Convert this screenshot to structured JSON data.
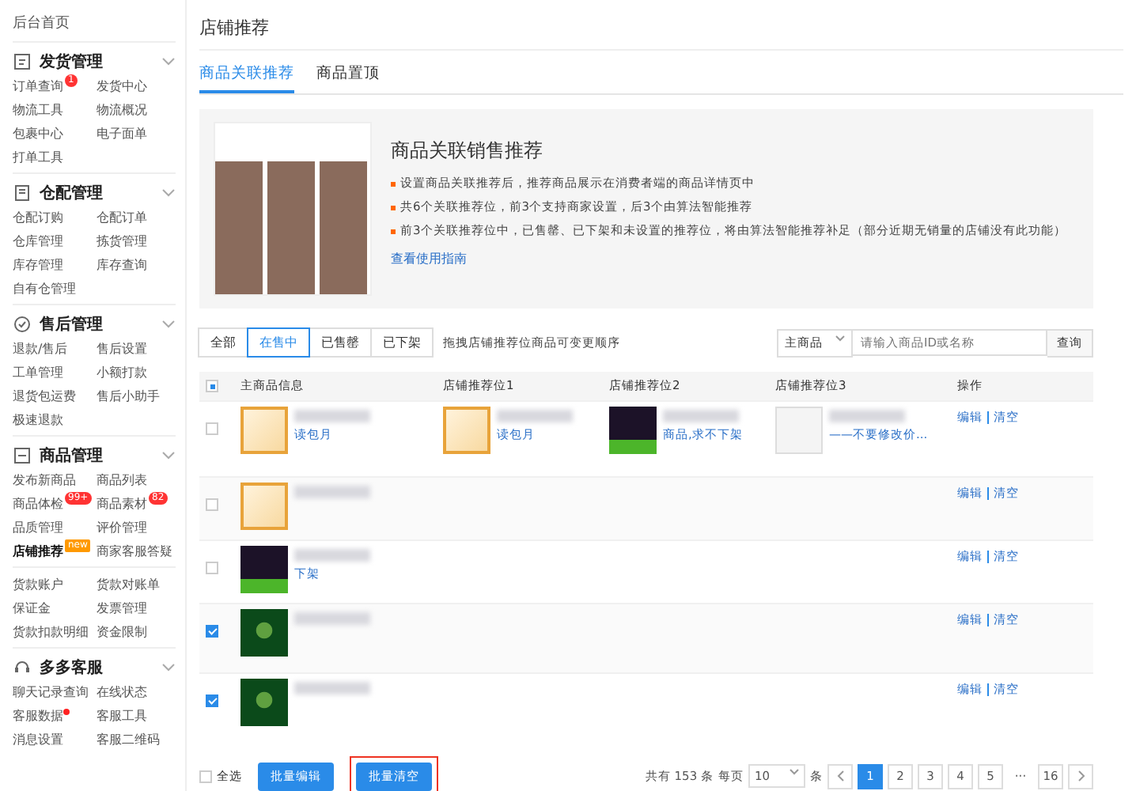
{
  "sidebar": {
    "home": "后台首页",
    "sections": [
      {
        "kind": "shipping",
        "title": "发货管理",
        "expanded": true,
        "items": [
          {
            "label": "订单查询",
            "badge": "1",
            "selected": false
          },
          {
            "label": "发货中心",
            "selected": false
          },
          {
            "label": "物流工具",
            "selected": false
          },
          {
            "label": "物流概况",
            "selected": false
          },
          {
            "label": "包裹中心",
            "selected": false
          },
          {
            "label": "电子面单",
            "selected": false
          },
          {
            "label": "打单工具",
            "selected": false
          }
        ]
      },
      {
        "kind": "warehouse",
        "title": "仓配管理",
        "expanded": true,
        "items": [
          {
            "label": "仓配订购",
            "selected": false
          },
          {
            "label": "仓配订单",
            "selected": false
          },
          {
            "label": "仓库管理",
            "selected": false
          },
          {
            "label": "拣货管理",
            "selected": false
          },
          {
            "label": "库存管理",
            "selected": false
          },
          {
            "label": "库存查询",
            "selected": false
          },
          {
            "label": "自有仓管理",
            "selected": false
          }
        ]
      },
      {
        "kind": "aftersale",
        "title": "售后管理",
        "expanded": true,
        "items": [
          {
            "label": "退款/售后",
            "selected": false
          },
          {
            "label": "售后设置",
            "selected": false
          },
          {
            "label": "工单管理",
            "selected": false
          },
          {
            "label": "小额打款",
            "selected": false
          },
          {
            "label": "退货包运费",
            "selected": false
          },
          {
            "label": "售后小助手",
            "selected": false
          },
          {
            "label": "极速退款",
            "selected": false
          }
        ]
      },
      {
        "kind": "goods",
        "title": "商品管理",
        "expanded": true,
        "items": [
          {
            "label": "发布新商品",
            "selected": false
          },
          {
            "label": "商品列表",
            "selected": false
          },
          {
            "label": "商品体检",
            "badge": "99+",
            "selected": false
          },
          {
            "label": "商品素材",
            "badge": "82",
            "selected": false
          },
          {
            "label": "品质管理",
            "selected": false
          },
          {
            "label": "评价管理",
            "selected": false
          },
          {
            "label": "店铺推荐",
            "badge": "new",
            "selected": true
          },
          {
            "label": "商家客服答疑",
            "selected": false
          }
        ]
      },
      {
        "items": [
          {
            "label": "货款账户",
            "selected": false
          },
          {
            "label": "货款对账单",
            "selected": false
          },
          {
            "label": "保证金",
            "selected": false
          },
          {
            "label": "发票管理",
            "selected": false
          },
          {
            "label": "货款扣款明细",
            "selected": false
          },
          {
            "label": "资金限制",
            "selected": false
          }
        ]
      },
      {
        "kind": "service",
        "title": "多多客服",
        "expanded": true,
        "items": [
          {
            "label": "聊天记录查询",
            "selected": false
          },
          {
            "label": "在线状态",
            "selected": false
          },
          {
            "label": "客服数据",
            "dot": true,
            "selected": false
          },
          {
            "label": "客服工具",
            "selected": false
          },
          {
            "label": "消息设置",
            "selected": false
          },
          {
            "label": "客服二维码",
            "selected": false
          }
        ]
      }
    ]
  },
  "page_title": "店铺推荐",
  "tabs": [
    {
      "label": "商品关联推荐",
      "selected": true
    },
    {
      "label": "商品置顶",
      "selected": false
    }
  ],
  "info": {
    "heading": "商品关联销售推荐",
    "bullets": [
      "设置商品关联推荐后，推荐商品展示在消费者端的商品详情页中",
      "共6个关联推荐位，前3个支持商家设置，后3个由算法智能推荐",
      "前3个关联推荐位中，已售罄、已下架和未设置的推荐位，将由算法智能推荐补足（部分近期无销量的店铺没有此功能）"
    ],
    "link": "查看使用指南"
  },
  "filters": [
    {
      "label": "全部",
      "selected": false
    },
    {
      "label": "在售中",
      "selected": true
    },
    {
      "label": "已售罄",
      "selected": false
    },
    {
      "label": "已下架",
      "selected": false
    }
  ],
  "filter_hint": "拖拽店铺推荐位商品可变更顺序",
  "search": {
    "type": "主商品",
    "placeholder": "请输入商品ID或名称",
    "button": "查询"
  },
  "table": {
    "select_all": {
      "indeterminate": true
    },
    "columns": [
      "主商品信息",
      "店铺推荐位1",
      "店铺推荐位2",
      "店铺推荐位3",
      "操作"
    ],
    "rows": [
      {
        "checked": false,
        "main": {
          "kind": "card",
          "caption": "读包月"
        },
        "slots": [
          {
            "kind": "card",
            "caption": "读包月"
          },
          {
            "kind": "dark",
            "caption": "商品,求不下架"
          },
          {
            "kind": "screen",
            "caption": "——不要修改价..."
          }
        ],
        "actions": [
          "编辑",
          "清空"
        ]
      },
      {
        "checked": false,
        "main": {
          "kind": "card"
        },
        "slots": [],
        "actions": [
          "编辑",
          "清空"
        ]
      },
      {
        "checked": false,
        "main": {
          "kind": "dark",
          "caption": "下架"
        },
        "slots": [],
        "actions": [
          "编辑",
          "清空"
        ]
      },
      {
        "checked": true,
        "main": {
          "kind": "leaf"
        },
        "slots": [],
        "actions": [
          "编辑",
          "清空"
        ]
      },
      {
        "checked": true,
        "main": {
          "kind": "leaf"
        },
        "slots": [],
        "actions": [
          "编辑",
          "清空"
        ]
      }
    ]
  },
  "footer": {
    "select_all": {
      "label": "全选",
      "checked": false
    },
    "buttons": [
      {
        "label": "批量编辑",
        "highlighted": false
      },
      {
        "label": "批量清空",
        "highlighted": true
      }
    ],
    "total": "共有 153 条",
    "per_page_label": "每页",
    "per_page": "10",
    "per_page_unit": "条",
    "pages": [
      {
        "label": "1",
        "selected": true
      },
      {
        "label": "2",
        "selected": false
      },
      {
        "label": "3",
        "selected": false
      },
      {
        "label": "4",
        "selected": false
      },
      {
        "label": "5",
        "selected": false
      },
      {
        "label": "···",
        "kind": "gap",
        "selected": false
      },
      {
        "label": "16",
        "selected": false
      }
    ]
  }
}
